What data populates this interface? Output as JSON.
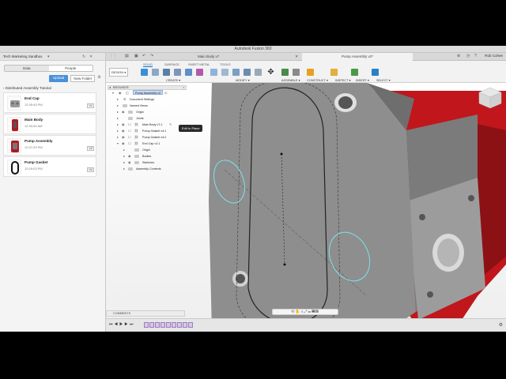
{
  "window": {
    "title": "Autodesk Fusion 360"
  },
  "data_panel": {
    "team": "Tech Marketing Sandbox",
    "tabs": [
      "Data",
      "People"
    ],
    "upload_label": "Upload",
    "new_folder_label": "New Folder",
    "breadcrumb": "Distributed Assembly Tutorial",
    "files": [
      {
        "name": "End Cap",
        "time": "12:35:43 PM",
        "version": "V1"
      },
      {
        "name": "Main Body",
        "time": "12:30:00 AM",
        "version": ""
      },
      {
        "name": "Pump Assembly",
        "time": "12:37:29 PM",
        "version": "V2"
      },
      {
        "name": "Pump Gasket",
        "time": "12:29:03 PM",
        "version": "V4"
      }
    ]
  },
  "doc_tabs": [
    "Main Body v7",
    "Pump Assembly v2*"
  ],
  "user": "Rob Cohee",
  "toolbar": {
    "design_label": "DESIGN",
    "tabs": [
      "SOLID",
      "SURFACE",
      "SHEET METAL",
      "TOOLS"
    ],
    "groups": [
      "CREATE",
      "MODIFY",
      "ASSEMBLE",
      "CONSTRUCT",
      "INSPECT",
      "INSERT",
      "SELECT"
    ]
  },
  "browser": {
    "title": "BROWSER",
    "root": "Pump Assembly v2",
    "rows": [
      "Document Settings",
      "Named Views",
      "Origin",
      "Joints",
      "Main Body v7:1",
      "Pump Gasket v4:1",
      "Pump Gasket v4:2",
      "End Cap v1:1",
      "Origin",
      "Bodies",
      "Sketches",
      "Assembly Contexts"
    ]
  },
  "tooltip": "Edit In Place",
  "comments_label": "COMMENTS",
  "colors": {
    "body_gray": "#8e8e8e",
    "part_red": "#c0161c",
    "accent": "#1a6fbf"
  }
}
